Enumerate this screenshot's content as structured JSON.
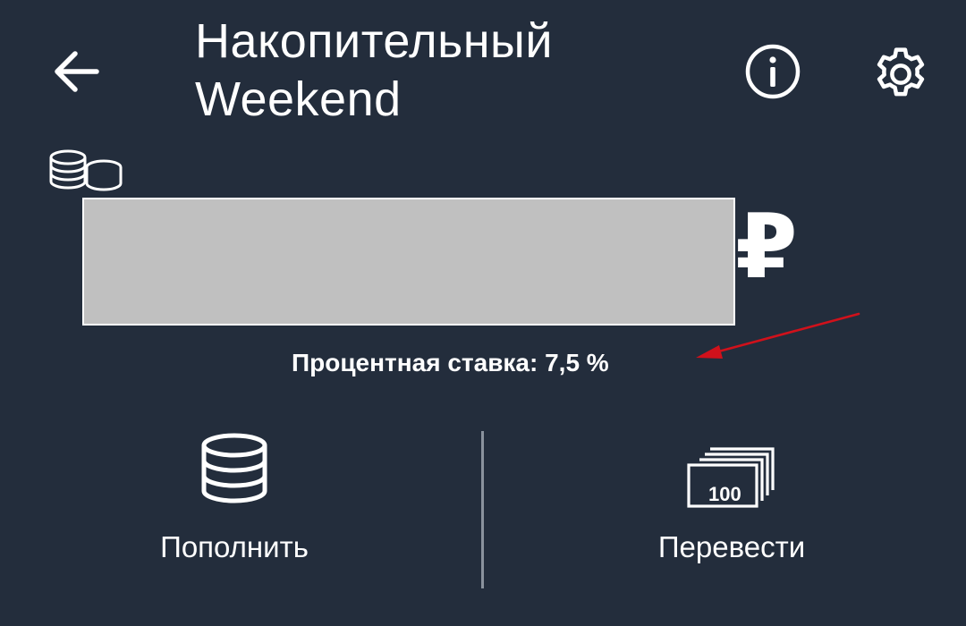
{
  "header": {
    "title_line1": "Накопительный",
    "title_line2": "Weekend",
    "back_icon": "arrow-left-icon",
    "info_icon": "info-circle-icon",
    "settings_icon": "gear-icon"
  },
  "account": {
    "type_icon": "coins-icon",
    "balance_hidden": true,
    "currency_symbol": "₽",
    "interest_rate_text": "Процентная ставка: 7,5 %"
  },
  "actions": [
    {
      "label": "Пополнить",
      "icon": "database-icon"
    },
    {
      "label": "Перевести",
      "icon": "banknotes-icon"
    }
  ],
  "annotation": {
    "arrow_color": "#d0111b"
  },
  "colors": {
    "background": "#232d3c",
    "text": "#ffffff",
    "divider": "#8a929d",
    "mask": "#c0c0c0"
  }
}
